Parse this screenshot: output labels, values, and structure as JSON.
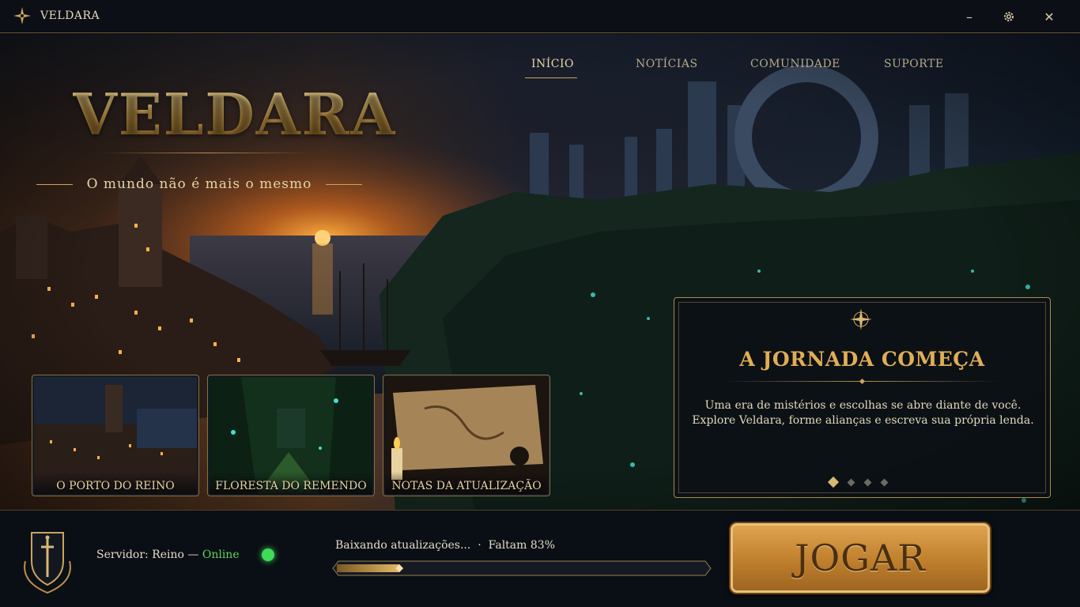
{
  "window": {
    "title": "VELDARA",
    "controls": {
      "minimize": "–",
      "settings": "⚙",
      "close": "✕"
    }
  },
  "brand": {
    "logo": "VELDARA",
    "tagline": "O mundo não é mais o mesmo"
  },
  "nav": {
    "items": [
      {
        "label": "INÍCIO",
        "active": true
      },
      {
        "label": "NOTÍCIAS",
        "active": false
      },
      {
        "label": "COMUNIDADE",
        "active": false
      },
      {
        "label": "SUPORTE",
        "active": false
      }
    ]
  },
  "thumbnails": [
    {
      "label": "O PORTO DO REINO"
    },
    {
      "label": "FLORESTA DO REMENDO"
    },
    {
      "label": "NOTAS DA ATUALIZAÇÃO"
    }
  ],
  "news": {
    "title": "A JORNADA COMEÇA",
    "body": "Uma era de mistérios e escolhas se abre diante de você. Explore Veldara, forme alianças e escreva sua própria lenda.",
    "slides": 4,
    "active_slide": 1
  },
  "server": {
    "label": "Servidor: Reino — ",
    "status": "Online",
    "status_color": "#5cd65c"
  },
  "download": {
    "status": "Baixando atualizações...",
    "separator": "·",
    "remaining": "Faltam 83%",
    "progress_fraction": 0.17
  },
  "play_button": {
    "label": "JOGAR"
  },
  "colors": {
    "accent_gold": "#c9a45c",
    "title_gold": "#e0ae55",
    "online_green": "#3fdc5a"
  }
}
